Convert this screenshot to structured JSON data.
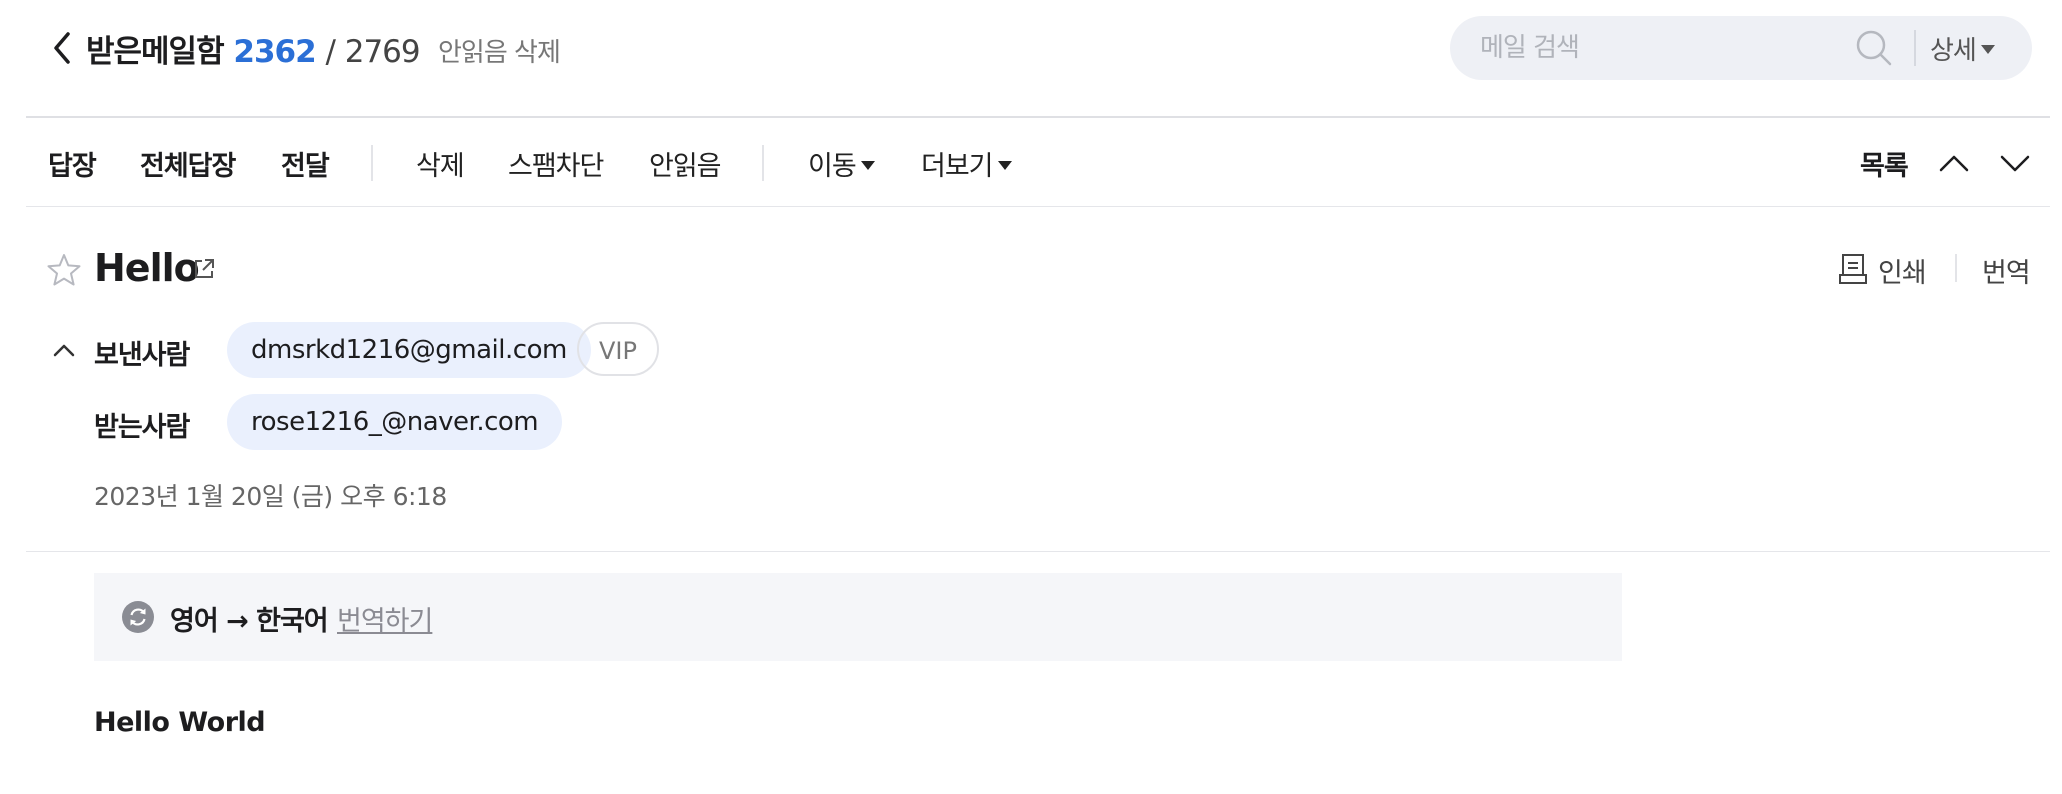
{
  "header": {
    "folder_name": "받은메일함",
    "unread_count": "2362",
    "slash": "/",
    "total_count": "2769",
    "delete_unread": "안읽음 삭제",
    "search_placeholder": "메일 검색",
    "search_detail": "상세"
  },
  "toolbar": {
    "reply": "답장",
    "reply_all": "전체답장",
    "forward": "전달",
    "delete": "삭제",
    "block_spam": "스팸차단",
    "mark_unread": "안읽음",
    "move": "이동",
    "more": "더보기",
    "list": "목록"
  },
  "mail": {
    "subject": "Hello",
    "print": "인쇄",
    "translate": "번역",
    "sender_label": "보낸사람",
    "sender": "dmsrkd1216@gmail.com",
    "vip": "VIP",
    "recipient_label": "받는사람",
    "recipient": "rose1216_@naver.com",
    "date": "2023년 1월 20일 (금) 오후 6:18"
  },
  "translate_banner": {
    "lang_pair": "영어 → 한국어",
    "action": "번역하기"
  },
  "body": {
    "text": "Hello World"
  },
  "icons": {
    "back": "chevron-left-icon",
    "search": "search-icon",
    "prev": "chevron-up-icon",
    "next": "chevron-down-icon",
    "star": "star-icon",
    "popout": "external-link-icon",
    "print": "printer-icon",
    "collapse": "chevron-up-icon",
    "refresh": "refresh-icon"
  },
  "colors": {
    "accent": "#2b6fd6",
    "chip_bg": "#eaf0fd",
    "banner_bg": "#f5f6f9",
    "search_bg": "#eef0f5"
  }
}
